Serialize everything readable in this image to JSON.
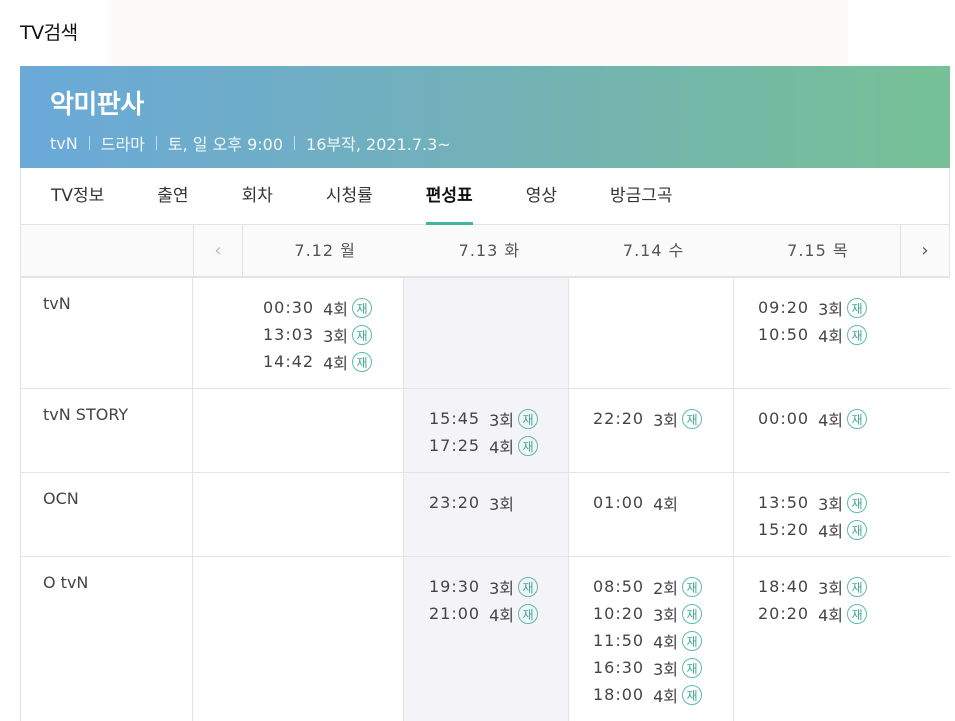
{
  "page": {
    "title": "TV검색"
  },
  "show": {
    "title": "악미판사",
    "meta": [
      "tvN",
      "드라마",
      "토, 일 오후 9:00",
      "16부작, 2021.7.3~"
    ]
  },
  "tabs": [
    {
      "label": "TV정보"
    },
    {
      "label": "출연"
    },
    {
      "label": "회차"
    },
    {
      "label": "시청률"
    },
    {
      "label": "편성표"
    },
    {
      "label": "영상"
    },
    {
      "label": "방금그곡"
    }
  ],
  "nav": {
    "prev": "‹",
    "next": "›"
  },
  "dates": [
    "7.12 월",
    "7.13 화",
    "7.14 수",
    "7.15 목"
  ],
  "rerun_badge": "재",
  "schedule": [
    {
      "channel": "tvN",
      "days": [
        [
          {
            "time": "00:30",
            "ep": "4회",
            "rerun": true
          },
          {
            "time": "13:03",
            "ep": "3회",
            "rerun": true
          },
          {
            "time": "14:42",
            "ep": "4회",
            "rerun": true
          }
        ],
        [],
        [],
        [
          {
            "time": "09:20",
            "ep": "3회",
            "rerun": true
          },
          {
            "time": "10:50",
            "ep": "4회",
            "rerun": true
          }
        ]
      ]
    },
    {
      "channel": "tvN STORY",
      "days": [
        [],
        [
          {
            "time": "15:45",
            "ep": "3회",
            "rerun": true
          },
          {
            "time": "17:25",
            "ep": "4회",
            "rerun": true
          }
        ],
        [
          {
            "time": "22:20",
            "ep": "3회",
            "rerun": true
          }
        ],
        [
          {
            "time": "00:00",
            "ep": "4회",
            "rerun": true
          }
        ]
      ]
    },
    {
      "channel": "OCN",
      "days": [
        [],
        [
          {
            "time": "23:20",
            "ep": "3회",
            "rerun": false
          }
        ],
        [
          {
            "time": "01:00",
            "ep": "4회",
            "rerun": false
          }
        ],
        [
          {
            "time": "13:50",
            "ep": "3회",
            "rerun": true
          },
          {
            "time": "15:20",
            "ep": "4회",
            "rerun": true
          }
        ]
      ]
    },
    {
      "channel": "O tvN",
      "days": [
        [],
        [
          {
            "time": "19:30",
            "ep": "3회",
            "rerun": true
          },
          {
            "time": "21:00",
            "ep": "4회",
            "rerun": true
          }
        ],
        [
          {
            "time": "08:50",
            "ep": "2회",
            "rerun": true
          },
          {
            "time": "10:20",
            "ep": "3회",
            "rerun": true
          },
          {
            "time": "11:50",
            "ep": "4회",
            "rerun": true
          },
          {
            "time": "16:30",
            "ep": "3회",
            "rerun": true
          },
          {
            "time": "18:00",
            "ep": "4회",
            "rerun": true
          }
        ],
        [
          {
            "time": "18:40",
            "ep": "3회",
            "rerun": true
          },
          {
            "time": "20:20",
            "ep": "4회",
            "rerun": true
          }
        ]
      ]
    }
  ]
}
